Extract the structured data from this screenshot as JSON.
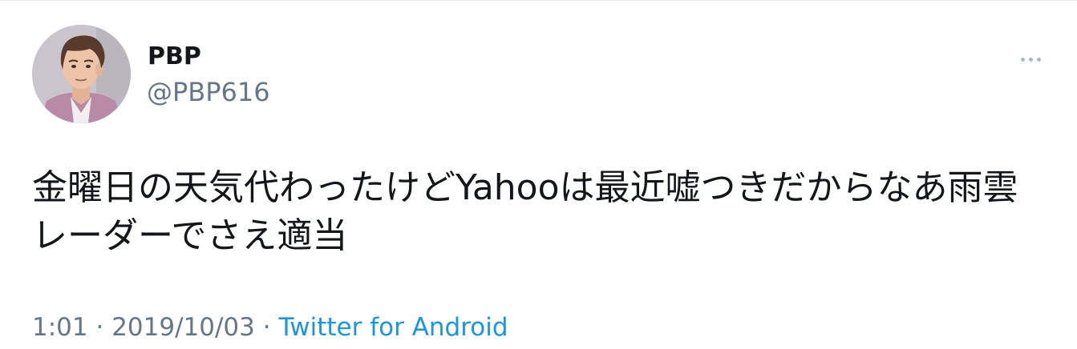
{
  "user": {
    "name": "PBP",
    "handle": "@PBP616"
  },
  "tweet": {
    "line1": "金曜日の天気代わったけどYahooは最近嘘つきだからなあ雨雲",
    "line2": "レーダーでさえ適当"
  },
  "meta": {
    "time": "1:01",
    "separator": "·",
    "date": "2019/10/03",
    "source": "Twitter for Android"
  },
  "icons": {
    "more": "more-horizontal-icon"
  },
  "colors": {
    "text": "#14171a",
    "secondary": "#657786",
    "link": "#1b95e0"
  }
}
